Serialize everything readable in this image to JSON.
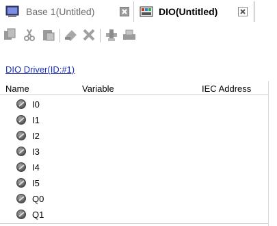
{
  "tabs": [
    {
      "label": "Base 1(Untitled)",
      "active": false,
      "icon": "screen-icon"
    },
    {
      "label": "DIO(Untitled)",
      "active": true,
      "icon": "dio-icon"
    }
  ],
  "toolbar": {
    "buttons": [
      "copy-icon",
      "cut-icon",
      "paste-icon",
      "add-icon",
      "delete-icon",
      "insert-icon",
      "print-icon"
    ]
  },
  "driver_link": "DIO Driver(ID:#1)",
  "table": {
    "columns": [
      "Name",
      "Variable",
      "IEC Address"
    ],
    "rows": [
      {
        "name": "I0",
        "variable": "",
        "iec_address": ""
      },
      {
        "name": "I1",
        "variable": "",
        "iec_address": ""
      },
      {
        "name": "I2",
        "variable": "",
        "iec_address": ""
      },
      {
        "name": "I3",
        "variable": "",
        "iec_address": ""
      },
      {
        "name": "I4",
        "variable": "",
        "iec_address": ""
      },
      {
        "name": "I5",
        "variable": "",
        "iec_address": ""
      },
      {
        "name": "Q0",
        "variable": "",
        "iec_address": ""
      },
      {
        "name": "Q1",
        "variable": "",
        "iec_address": ""
      }
    ]
  },
  "colors": {
    "link": "#1a2fb8",
    "tab_inactive_text": "#6b6b6b"
  }
}
